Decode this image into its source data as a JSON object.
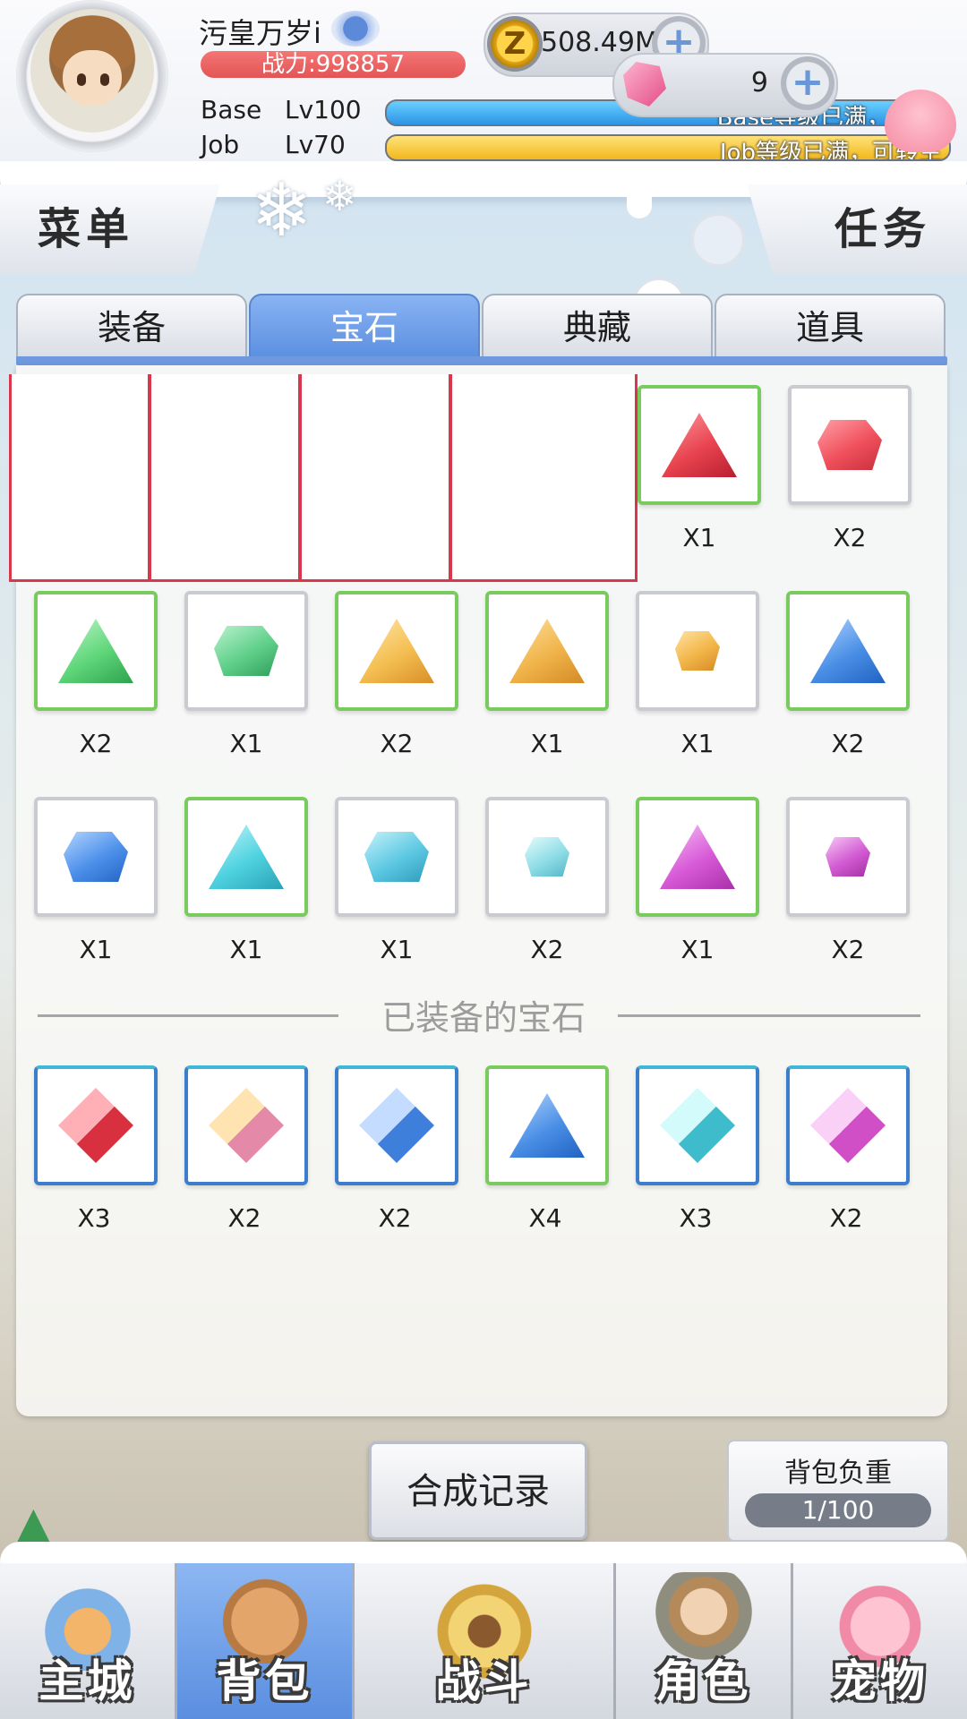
{
  "player": {
    "name": "污皇万岁i",
    "power": "战力:998857",
    "base_label": "Base",
    "base_level": "Lv100",
    "base_status": "Base等级已满，可",
    "job_label": "Job",
    "job_level": "Lv70",
    "job_status": "Job等级已满，可转生"
  },
  "currency": {
    "zeny": "508.49M",
    "gems": "9",
    "coin_symbol": "Z",
    "plus": "+"
  },
  "nav_top": {
    "menu": "菜单",
    "quest": "任务"
  },
  "tabs": [
    {
      "label": "装备",
      "active": false
    },
    {
      "label": "宝石",
      "active": true
    },
    {
      "label": "典藏",
      "active": false
    },
    {
      "label": "道具",
      "active": false
    }
  ],
  "inventory": {
    "row1": [
      {
        "count": "X1",
        "color": "#e8434f",
        "shape": "tri",
        "frame": "green"
      },
      {
        "count": "X2",
        "color": "#f0505c",
        "shape": "ore",
        "frame": "grey"
      }
    ],
    "row2": [
      {
        "count": "X2",
        "color": "#5fd67a",
        "shape": "tri",
        "frame": "green"
      },
      {
        "count": "X1",
        "color": "#5fcf8a",
        "shape": "ore",
        "frame": "grey"
      },
      {
        "count": "X2",
        "color": "#f4bf52",
        "shape": "tri",
        "frame": "green"
      },
      {
        "count": "X1",
        "color": "#f0b44a",
        "shape": "tri",
        "frame": "green"
      },
      {
        "count": "X1",
        "color": "#f2b548",
        "shape": "small",
        "frame": "grey"
      },
      {
        "count": "X2",
        "color": "#4a8fe6",
        "shape": "tri",
        "frame": "green"
      }
    ],
    "row3": [
      {
        "count": "X1",
        "color": "#4c90ea",
        "shape": "ore",
        "frame": "grey"
      },
      {
        "count": "X1",
        "color": "#4fd2e0",
        "shape": "tri",
        "frame": "green"
      },
      {
        "count": "X1",
        "color": "#5cc8e2",
        "shape": "ore",
        "frame": "grey"
      },
      {
        "count": "X2",
        "color": "#8fdde6",
        "shape": "small",
        "frame": "grey"
      },
      {
        "count": "X1",
        "color": "#d85ad8",
        "shape": "tri",
        "frame": "green"
      },
      {
        "count": "X2",
        "color": "#d25ad2",
        "shape": "small",
        "frame": "grey"
      }
    ]
  },
  "equipped": {
    "title": "已装备的宝石",
    "items": [
      {
        "count": "X3",
        "color": "#e8434f",
        "shape": "dia",
        "frame": "blue"
      },
      {
        "count": "X2",
        "color": "#f0b45a",
        "shape": "dia",
        "frame": "blue"
      },
      {
        "count": "X2",
        "color": "#5d98e8",
        "shape": "dia",
        "frame": "blue"
      },
      {
        "count": "X4",
        "color": "#4a8fe6",
        "shape": "tri",
        "frame": "green"
      },
      {
        "count": "X3",
        "color": "#5fd6dc",
        "shape": "dia",
        "frame": "blue"
      },
      {
        "count": "X2",
        "color": "#e26ad6",
        "shape": "dia",
        "frame": "blue"
      }
    ]
  },
  "footer": {
    "synthesis_record": "合成记录",
    "bag_weight_label": "背包负重",
    "bag_weight_value": "1/100"
  },
  "bottom_nav": [
    {
      "label": "主城",
      "icon": "castle-icon",
      "active": false
    },
    {
      "label": "背包",
      "icon": "backpack-icon",
      "active": true
    },
    {
      "label": "战斗",
      "icon": "battle-wheel-icon",
      "active": false
    },
    {
      "label": "角色",
      "icon": "character-icon",
      "active": false
    },
    {
      "label": "宠物",
      "icon": "pet-poring-icon",
      "active": false
    }
  ]
}
